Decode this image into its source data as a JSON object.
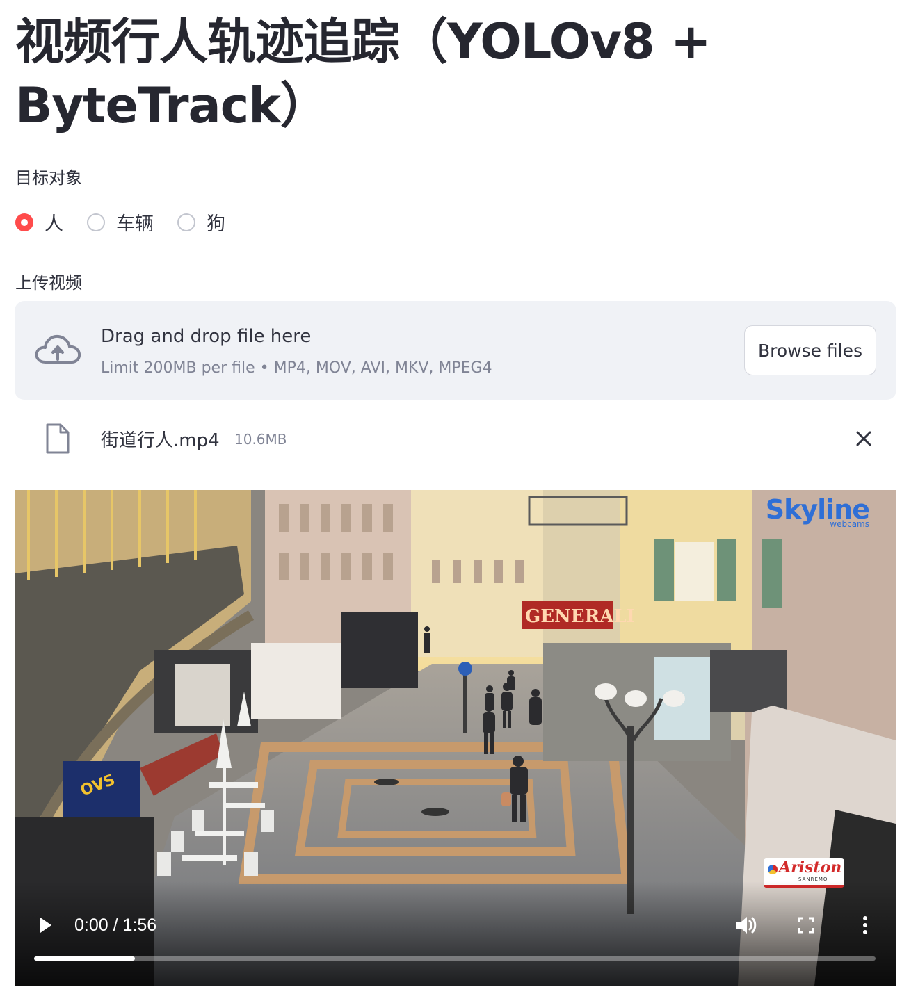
{
  "page": {
    "title": "视频行人轨迹追踪（YOLOv8 + ByteTrack）"
  },
  "target": {
    "label": "目标对象",
    "options": [
      {
        "label": "人",
        "checked": true
      },
      {
        "label": "车辆",
        "checked": false
      },
      {
        "label": "狗",
        "checked": false
      }
    ]
  },
  "upload": {
    "label": "上传视频",
    "drop_title": "Drag and drop file here",
    "drop_limit": "Limit 200MB per file • MP4, MOV, AVI, MKV, MPEG4",
    "browse_label": "Browse files",
    "file": {
      "name": "街道行人.mp4",
      "size": "10.6MB"
    }
  },
  "video": {
    "time_display": "0:00 / 1:56",
    "buffered_fraction": 0.12,
    "watermarks": {
      "skyline": "Skyline",
      "skyline_sub": "webcams",
      "ariston": "Ariston",
      "ariston_city": "SANREMO",
      "shop_sign": "GENERALI",
      "ovs": "OVS"
    }
  },
  "icons": {
    "upload": "cloud-upload-icon",
    "file": "file-icon",
    "close": "close-icon",
    "play": "play-icon",
    "volume": "volume-icon",
    "fullscreen": "fullscreen-icon",
    "more": "more-vertical-icon"
  },
  "colors": {
    "accent": "#ff4b4b",
    "dropzone_bg": "#f0f2f6",
    "text": "#31333f",
    "muted": "#808495"
  }
}
